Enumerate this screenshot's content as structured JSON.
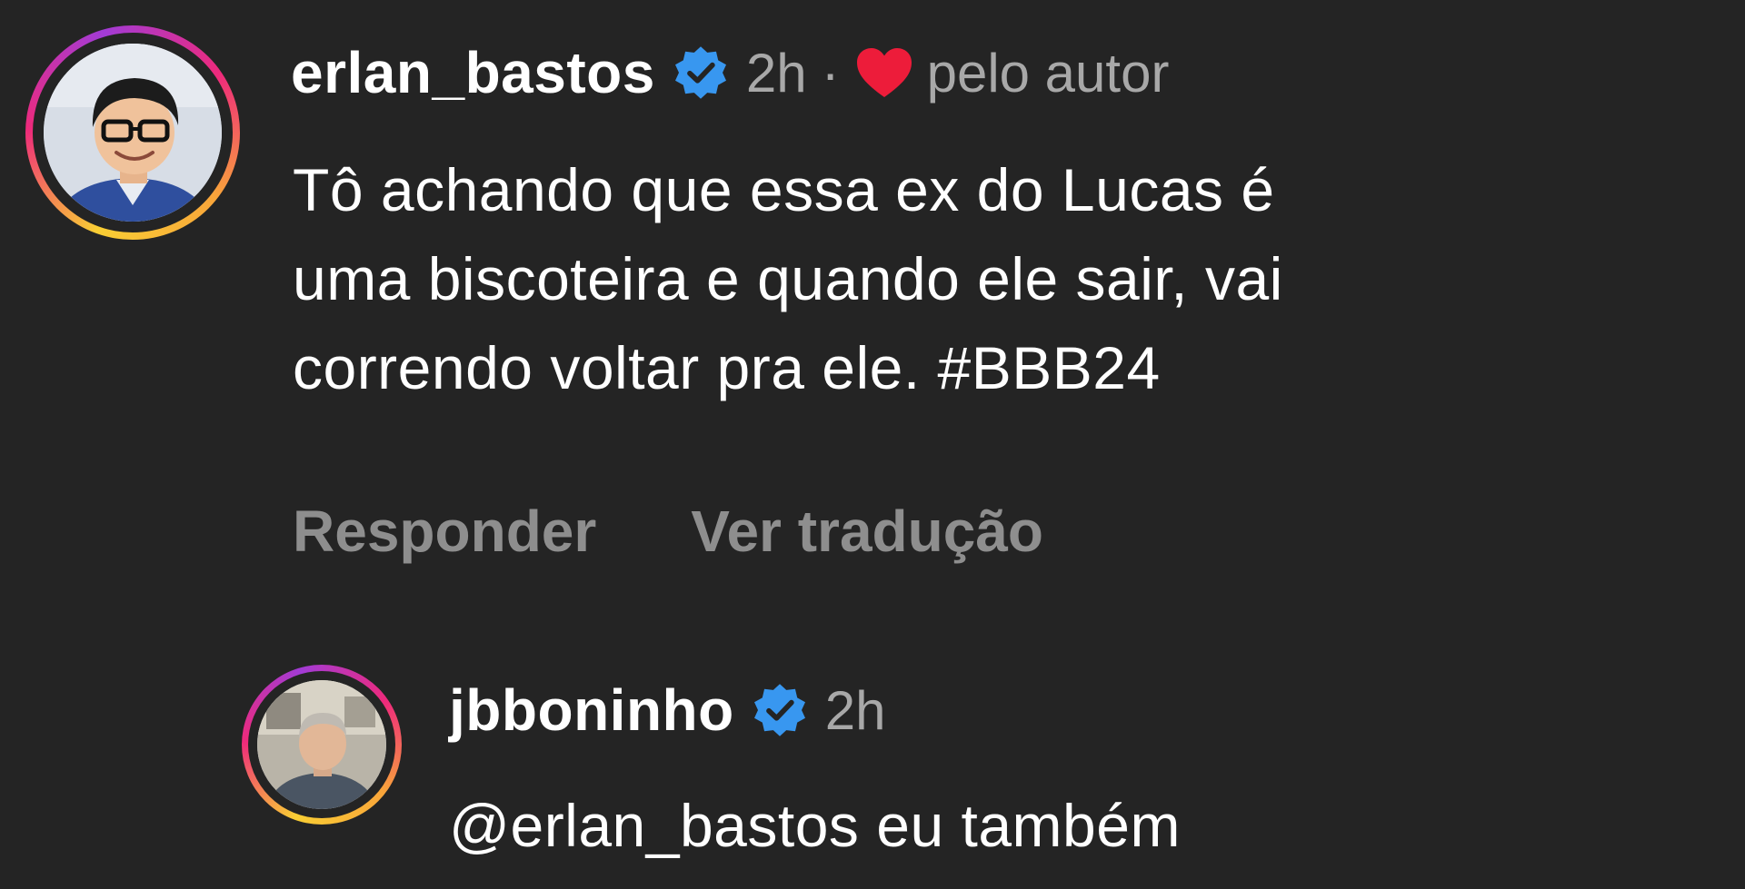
{
  "colors": {
    "background": "#242424",
    "primary_text": "#ffffff",
    "secondary_text": "#a8a8a8",
    "action_text": "#8e8e8e",
    "verified_badge": "#3897f0",
    "heart": "#ed1c3a"
  },
  "comments": [
    {
      "username": "erlan_bastos",
      "verified_icon": "verified-badge-icon",
      "time": "2h",
      "separator": "·",
      "liked_icon": "heart-icon",
      "liked_by": "pelo autor",
      "lines": [
        "Tô achando que essa ex do Lucas é",
        "uma biscoteira e quando ele sair, vai",
        "correndo voltar pra ele. #BBB24"
      ],
      "actions": {
        "reply": "Responder",
        "translate": "Ver tradução"
      }
    },
    {
      "username": "jbboninho",
      "verified_icon": "verified-badge-icon",
      "time": "2h",
      "text": "@erlan_bastos eu também"
    }
  ]
}
